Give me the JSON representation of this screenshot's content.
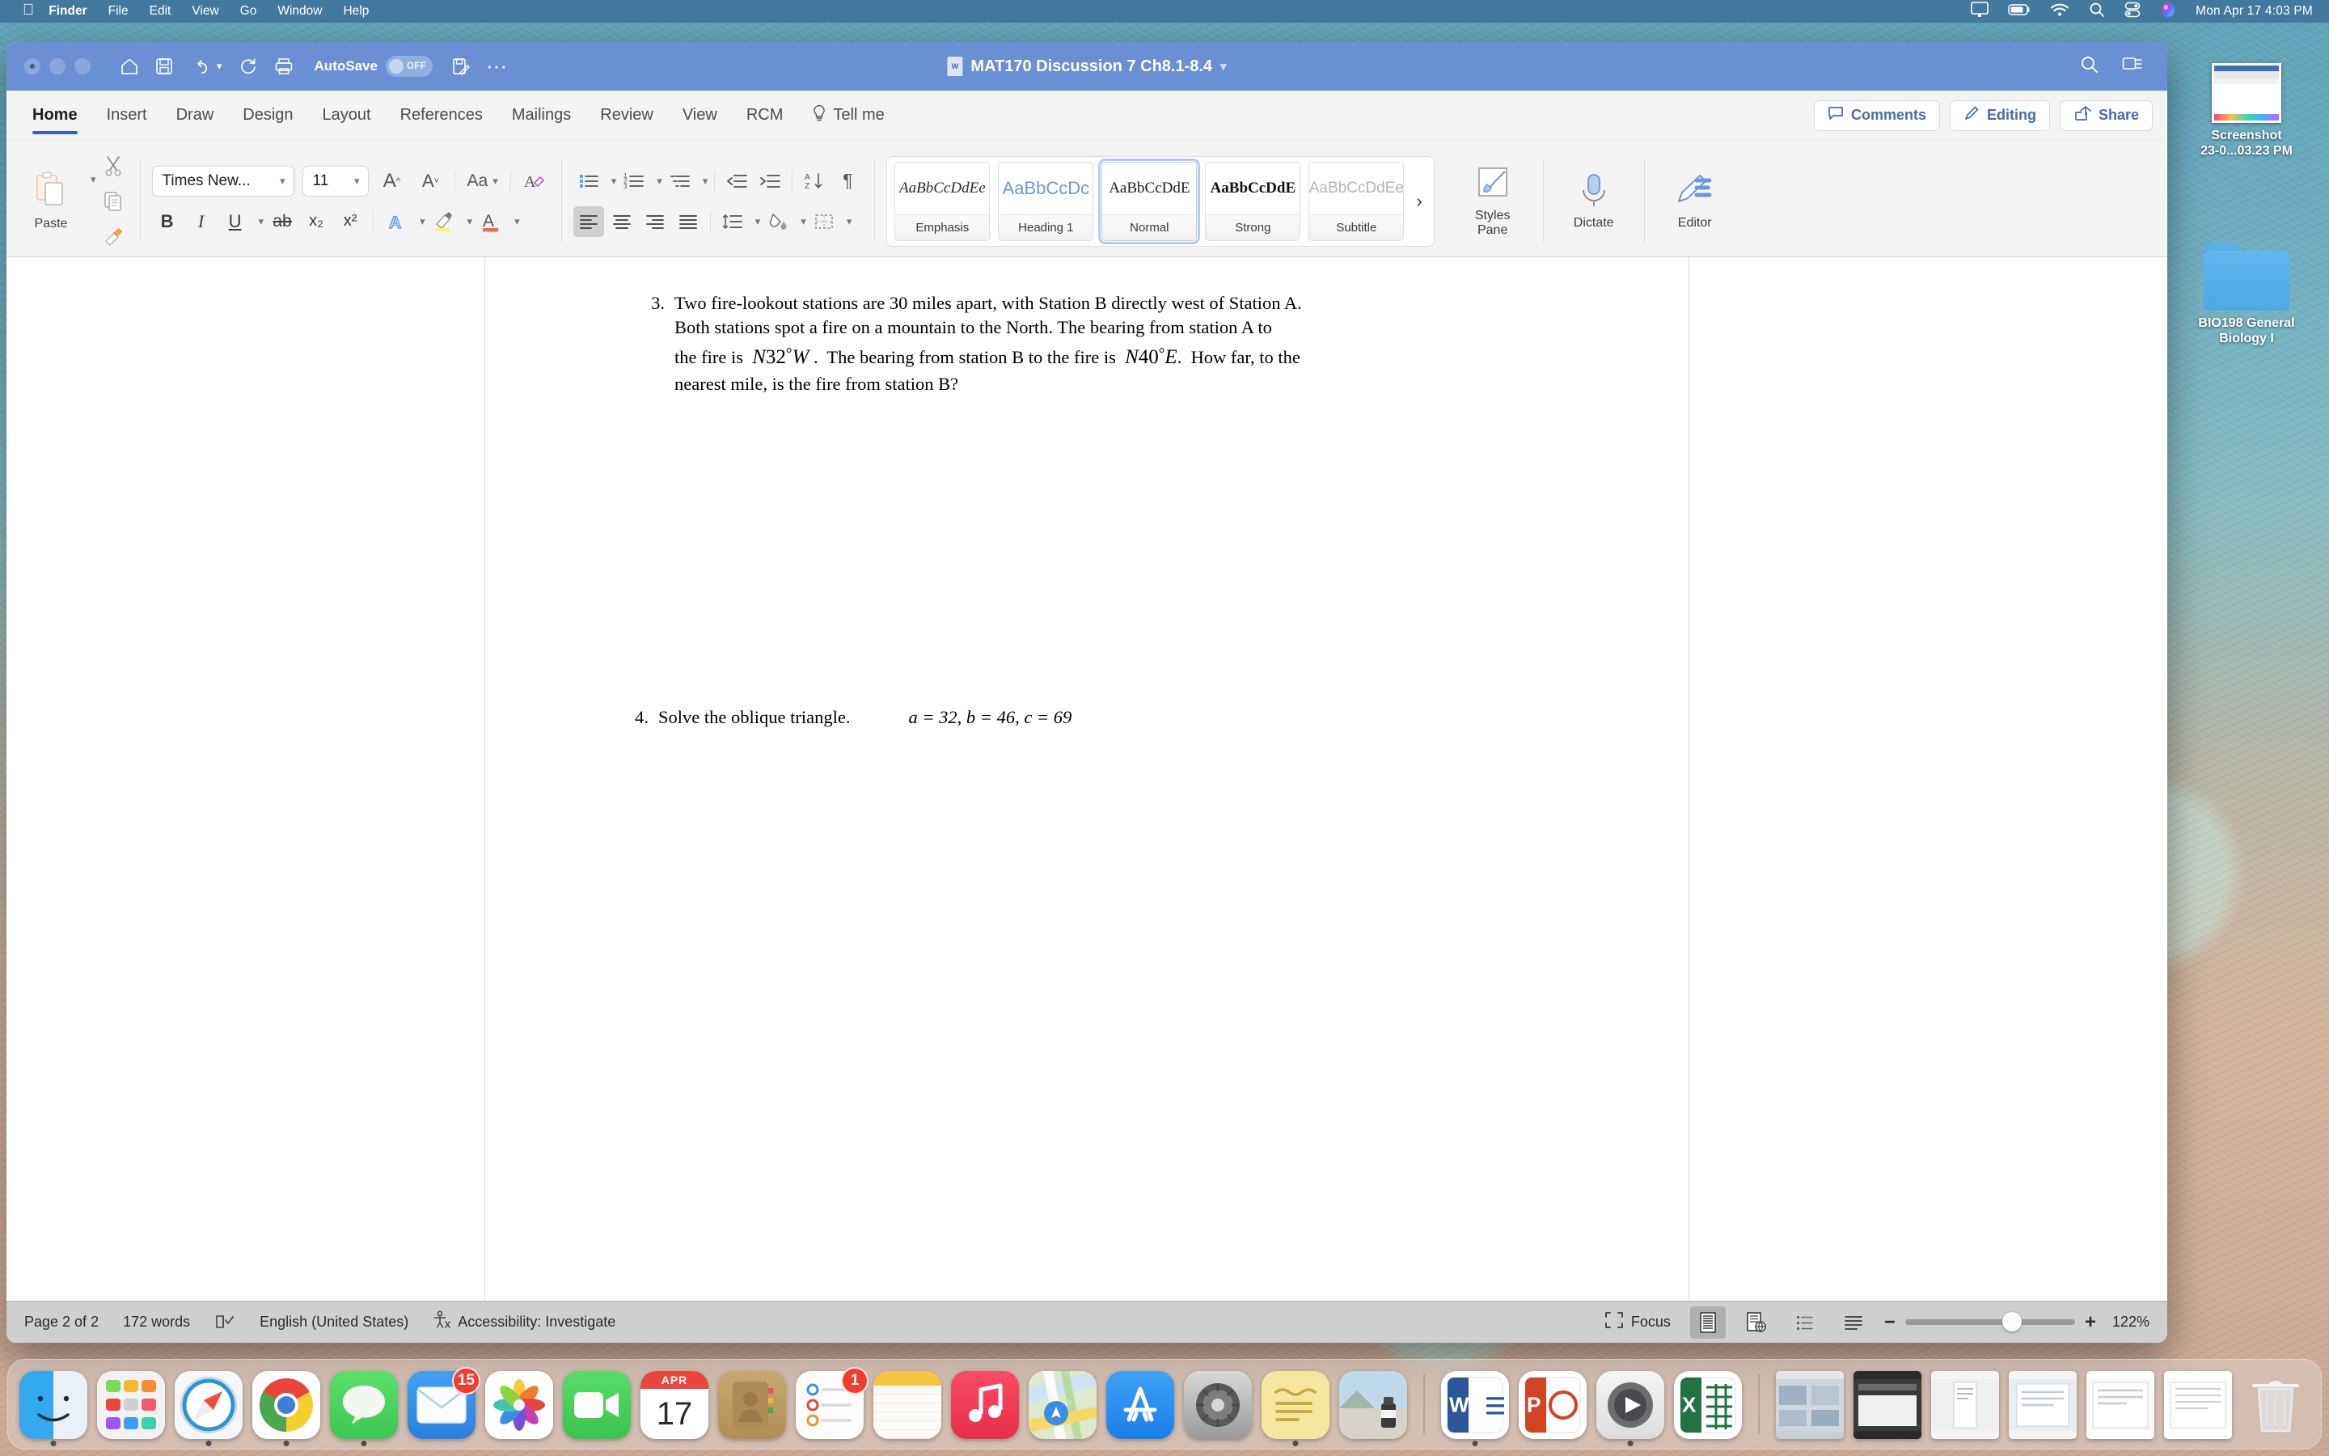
{
  "menubar": {
    "apple_icon": "apple-icon",
    "items": [
      {
        "label": "Finder",
        "bold": true
      },
      {
        "label": "File",
        "bold": false
      },
      {
        "label": "Edit",
        "bold": false
      },
      {
        "label": "View",
        "bold": false
      },
      {
        "label": "Go",
        "bold": false
      },
      {
        "label": "Window",
        "bold": false
      },
      {
        "label": "Help",
        "bold": false
      }
    ],
    "status_icons": [
      "display-icon",
      "battery-icon",
      "wifi-icon",
      "search-icon",
      "control-center-icon",
      "siri-icon"
    ],
    "clock": "Mon Apr 17  4:03 PM"
  },
  "desktop": {
    "icons": [
      {
        "name": "Screenshot",
        "line1": "Screenshot",
        "line2": "23-0...03.23 PM",
        "type": "screenshot-thumbnail"
      },
      {
        "name": "BIO198 General Biology I",
        "line1": "BIO198 General",
        "line2": "Biology I",
        "type": "folder"
      }
    ]
  },
  "window": {
    "title": "MAT170 Discussion 7 Ch8.1-8.4",
    "quick_access": [
      "home-icon",
      "save-icon",
      "undo-icon",
      "redo-icon",
      "print-icon"
    ],
    "autosave": {
      "label": "AutoSave",
      "state": "OFF"
    },
    "after_autosave_icons": [
      "save-as-icon",
      "more-options-icon"
    ],
    "titlebar_right_icons": [
      "search-icon",
      "ribbon-display-icon"
    ]
  },
  "ribbon": {
    "tabs": [
      {
        "label": "Home",
        "active": true
      },
      {
        "label": "Insert",
        "active": false
      },
      {
        "label": "Draw",
        "active": false
      },
      {
        "label": "Design",
        "active": false
      },
      {
        "label": "Layout",
        "active": false
      },
      {
        "label": "References",
        "active": false
      },
      {
        "label": "Mailings",
        "active": false
      },
      {
        "label": "Review",
        "active": false
      },
      {
        "label": "View",
        "active": false
      },
      {
        "label": "RCM",
        "active": false
      }
    ],
    "tell_me": "Tell me",
    "right_buttons": [
      {
        "label": "Comments",
        "icon": "comment-icon"
      },
      {
        "label": "Editing",
        "icon": "pencil-icon"
      },
      {
        "label": "Share",
        "icon": "share-icon"
      }
    ],
    "clipboard": {
      "paste_label": "Paste",
      "cut_icon": "scissors-icon",
      "copy_icon": "copy-icon",
      "format_painter_icon": "format-painter-icon"
    },
    "font": {
      "family": "Times New...",
      "size": "11",
      "grow_icon": "grow-font-icon",
      "shrink_icon": "shrink-font-icon",
      "change_case_icon": "change-case-icon",
      "clear_formatting_icon": "clear-formatting-icon",
      "bold": "B",
      "italic": "I",
      "underline": "U",
      "strikethrough": "ab",
      "subscript": "x₂",
      "superscript": "x²",
      "text_effects_icon": "text-effects-icon",
      "highlight_icon": "highlight-icon",
      "font_color_icon": "font-color-icon"
    },
    "paragraph": {
      "bullets_icon": "bullet-list-icon",
      "numbering_icon": "numbered-list-icon",
      "multilevel_icon": "multilevel-list-icon",
      "decrease_indent_icon": "decrease-indent-icon",
      "increase_indent_icon": "increase-indent-icon",
      "sort_icon": "sort-icon",
      "show_marks_icon": "paragraph-marks-icon",
      "align_left_icon": "align-left-icon",
      "align_center_icon": "align-center-icon",
      "align_right_icon": "align-right-icon",
      "justify_icon": "justify-icon",
      "line_spacing_icon": "line-spacing-icon",
      "shading_icon": "shading-icon",
      "borders_icon": "borders-icon"
    },
    "styles": [
      {
        "preview": "AaBbCcDdEe",
        "name": "Emphasis",
        "active": false
      },
      {
        "preview": "AaBbCcDc",
        "name": "Heading 1",
        "active": false
      },
      {
        "preview": "AaBbCcDdE",
        "name": "Normal",
        "active": true
      },
      {
        "preview": "AaBbCcDdE",
        "name": "Strong",
        "active": false
      },
      {
        "preview": "AaBbCcDdEe",
        "name": "Subtitle",
        "active": false
      }
    ],
    "gallery_more": "›",
    "tools": [
      {
        "label": "Styles\nPane",
        "label_l1": "Styles",
        "label_l2": "Pane",
        "icon": "styles-pane-icon"
      },
      {
        "label": "Dictate",
        "label_l1": "Dictate",
        "label_l2": "",
        "icon": "microphone-icon"
      },
      {
        "label": "Editor",
        "label_l1": "Editor",
        "label_l2": "",
        "icon": "editor-icon"
      }
    ]
  },
  "document": {
    "questions": [
      {
        "number": "3.",
        "lines": [
          "Two fire-lookout stations are 30 miles apart, with Station B directly west of Station A.",
          "Both stations spot a fire on a mountain to the North.  The bearing from station A to",
          "the fire is  N32°W .  The bearing from station B to the fire is  N40°E.  How far, to the",
          "nearest mile, is the fire from station B?"
        ]
      },
      {
        "number": "4.",
        "lines": [
          "Solve the oblique triangle."
        ],
        "math": "a = 32,  b = 46,  c = 69"
      }
    ]
  },
  "statusbar": {
    "page": "Page 2 of 2",
    "words": "172 words",
    "proofing_icon": "proofing-icon",
    "language": "English (United States)",
    "accessibility_icon": "accessibility-icon",
    "accessibility": "Accessibility: Investigate",
    "focus_label": "Focus",
    "focus_icon": "focus-icon",
    "view_icons": [
      "print-layout-icon",
      "web-layout-icon",
      "outline-icon",
      "draft-icon"
    ],
    "zoom_out": "−",
    "zoom_in": "+",
    "zoom_level": "122%"
  },
  "dock": {
    "items": [
      {
        "name": "finder",
        "label": "Finder",
        "running": true,
        "badge": ""
      },
      {
        "name": "launchpad",
        "label": "Launchpad",
        "running": false,
        "badge": ""
      },
      {
        "name": "safari",
        "label": "Safari",
        "running": true,
        "badge": ""
      },
      {
        "name": "chrome",
        "label": "Google Chrome",
        "running": true,
        "badge": ""
      },
      {
        "name": "messages",
        "label": "Messages",
        "running": true,
        "badge": ""
      },
      {
        "name": "mail",
        "label": "Mail",
        "running": false,
        "badge": "15"
      },
      {
        "name": "photos",
        "label": "Photos",
        "running": false,
        "badge": ""
      },
      {
        "name": "facetime",
        "label": "FaceTime",
        "running": false,
        "badge": ""
      },
      {
        "name": "calendar",
        "label": "Calendar",
        "running": false,
        "badge": "",
        "cal_month": "APR",
        "cal_day": "17"
      },
      {
        "name": "contacts",
        "label": "Contacts",
        "running": false,
        "badge": ""
      },
      {
        "name": "reminders",
        "label": "Reminders",
        "running": false,
        "badge": "1"
      },
      {
        "name": "notes",
        "label": "Notes",
        "running": false,
        "badge": ""
      },
      {
        "name": "music",
        "label": "Music",
        "running": false,
        "badge": ""
      },
      {
        "name": "maps",
        "label": "Maps",
        "running": false,
        "badge": ""
      },
      {
        "name": "app-store",
        "label": "App Store",
        "running": false,
        "badge": ""
      },
      {
        "name": "system-preferences",
        "label": "System Preferences",
        "running": false,
        "badge": ""
      },
      {
        "name": "stickies",
        "label": "Stickies",
        "running": true,
        "badge": ""
      },
      {
        "name": "preview",
        "label": "Preview",
        "running": false,
        "badge": ""
      },
      {
        "name": "word",
        "label": "Microsoft Word",
        "running": true,
        "badge": "",
        "letter": "W"
      },
      {
        "name": "powerpoint",
        "label": "Microsoft PowerPoint",
        "running": false,
        "badge": "",
        "letter": "P"
      },
      {
        "name": "quicktime",
        "label": "QuickTime Player",
        "running": true,
        "badge": ""
      },
      {
        "name": "excel",
        "label": "Microsoft Excel",
        "running": false,
        "badge": "",
        "letter": "X"
      }
    ],
    "minimized": [
      {
        "name": "window-1"
      },
      {
        "name": "window-2"
      },
      {
        "name": "window-3"
      },
      {
        "name": "window-4"
      },
      {
        "name": "window-5"
      },
      {
        "name": "window-6"
      }
    ],
    "trash": {
      "name": "trash",
      "label": "Trash"
    }
  },
  "colors": {
    "accent_blue": "#3a5fab",
    "titlebar_blue": "#6a8fd4",
    "menubar_blue": "#3a7096",
    "word_blue": "#4a6ab5",
    "status_gray": "#cfcfcf"
  }
}
